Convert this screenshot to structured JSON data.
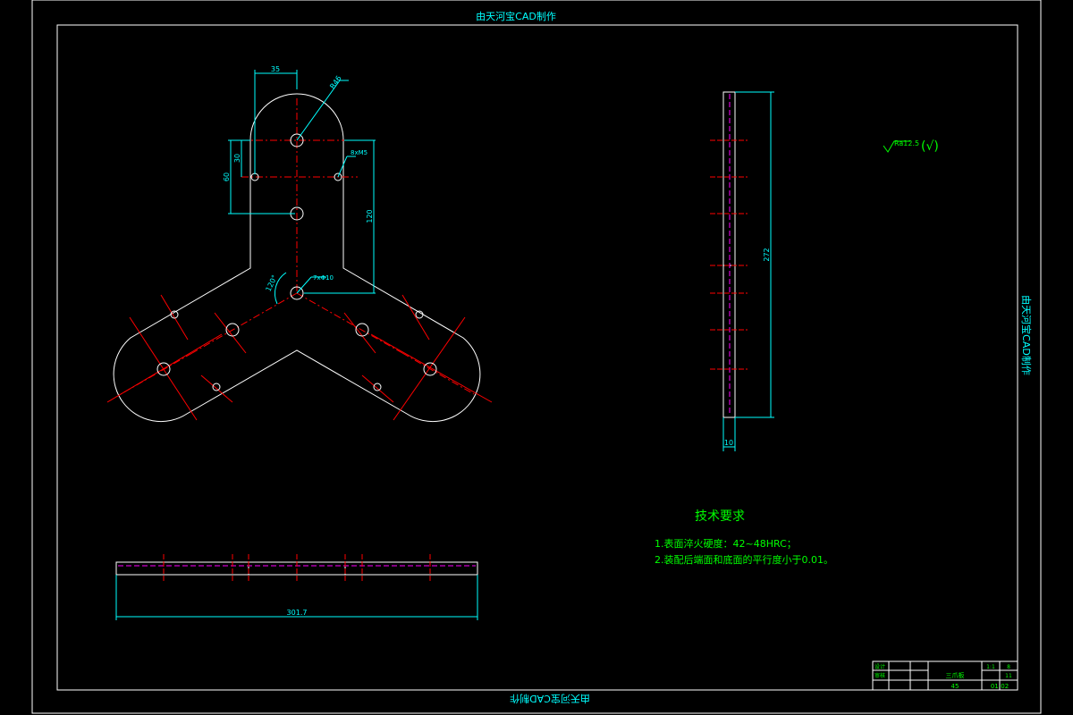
{
  "frame": {
    "title_top": "由天河宝CAD制作",
    "title_bottom": "由天河宝CAD制作",
    "title_side": "由天河宝CAD制作"
  },
  "dimensions": {
    "width_top": "35",
    "radius": "R46",
    "small_hole": "8xM5",
    "height_30": "30",
    "height_60": "60",
    "height_120": "120",
    "angle": "120°",
    "center_hole": "7xΦ10",
    "side_height": "272",
    "side_thickness": "10",
    "bottom_length": "301.7"
  },
  "roughness": {
    "label": "Ra12.5",
    "symbol": "(√)"
  },
  "requirements": {
    "title": "技术要求",
    "line1": "1.表面淬火硬度：42~48HRC；",
    "line2": "2.装配后端面和底面的平行度小于0.01。"
  },
  "title_block": {
    "label_design": "设计",
    "label_check": "审核",
    "part_name": "三爪板",
    "material": "45",
    "scale": "1:1",
    "count_a": "8",
    "count_b": "11",
    "drawing_no": "01-02"
  },
  "colors": {
    "frame": "#00ffff",
    "outline": "#ffffff",
    "center": "#ff0000",
    "dimension": "#00ffff",
    "text": "#00ff00",
    "hidden": "#ff00ff"
  }
}
